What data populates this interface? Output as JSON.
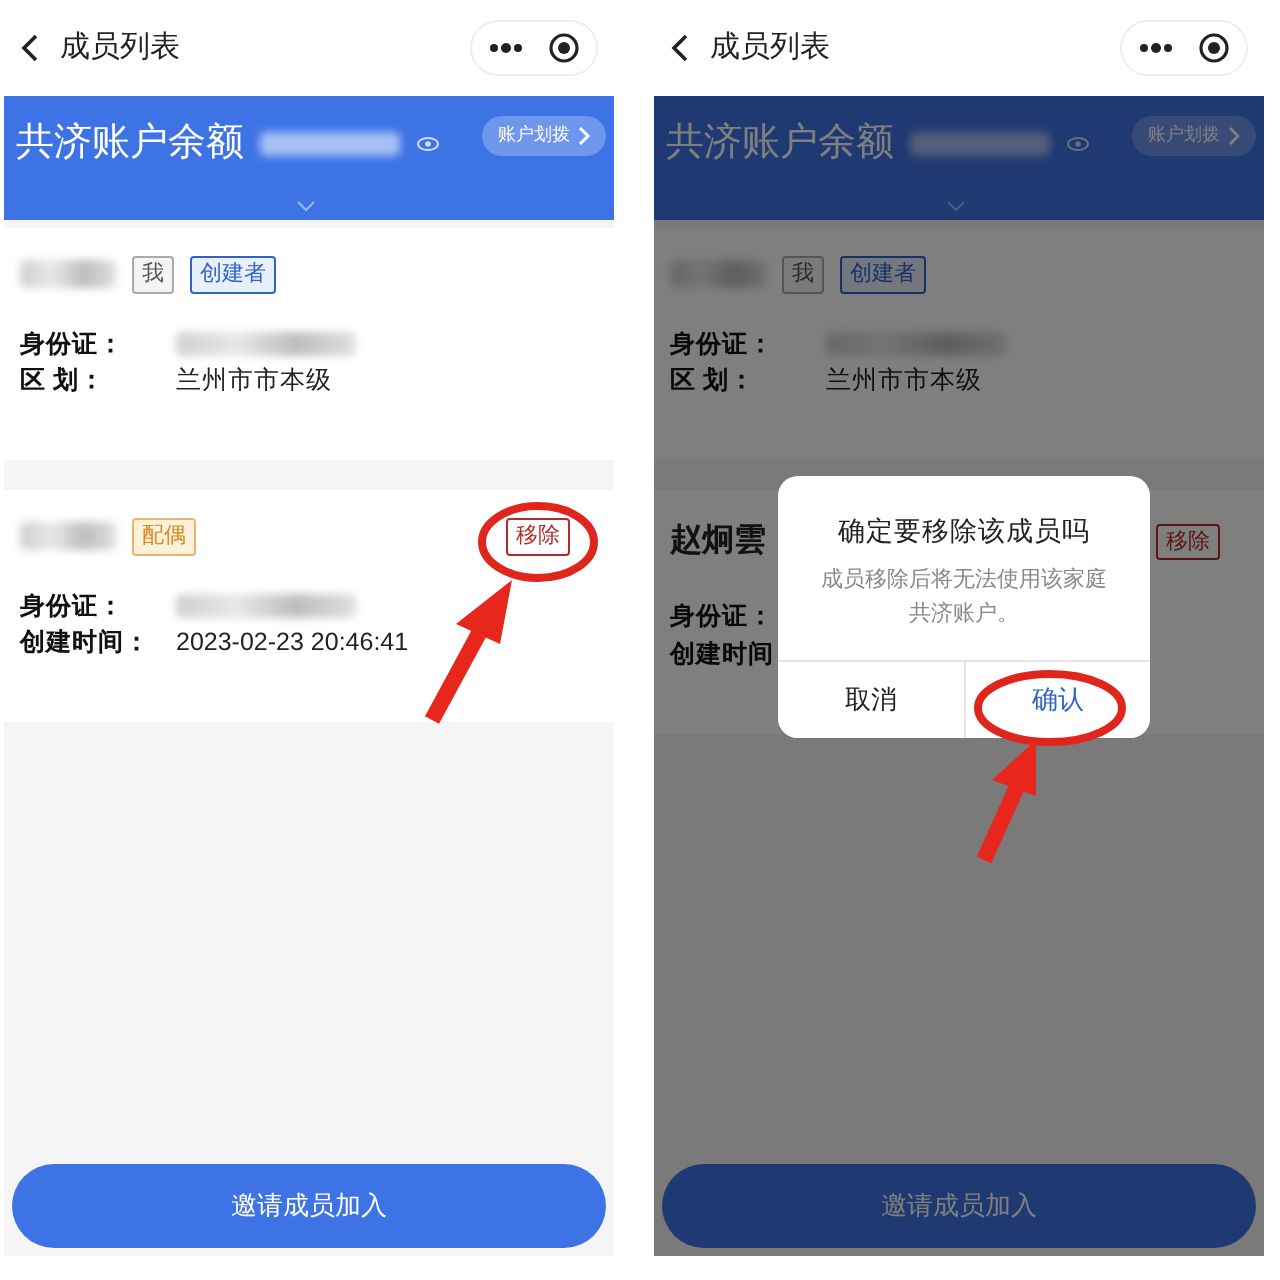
{
  "screens": [
    {
      "nav": {
        "title": "成员列表"
      },
      "banner": {
        "title": "共济账户余额",
        "amount_redacted": true,
        "action": "账户划拨"
      },
      "dimmed": false,
      "members": [
        {
          "name_redacted": true,
          "tags": [
            {
              "kind": "plain",
              "text": "我"
            },
            {
              "kind": "creator",
              "text": "创建者"
            }
          ],
          "removable": false,
          "rows": [
            {
              "label": "身份证：",
              "redacted": true
            },
            {
              "label": "区 划：",
              "value": "兰州市市本级"
            }
          ]
        },
        {
          "name_redacted": true,
          "tags": [
            {
              "kind": "spouse",
              "text": "配偶"
            }
          ],
          "removable": true,
          "remove_label": "移除",
          "rows": [
            {
              "label": "身份证：",
              "redacted": true
            },
            {
              "label": "创建时间：",
              "value": "2023-02-23 20:46:41"
            }
          ]
        }
      ],
      "invite": "邀请成员加入"
    },
    {
      "nav": {
        "title": "成员列表"
      },
      "banner": {
        "title": "共济账户余额",
        "amount_redacted": true,
        "action": "账户划拨"
      },
      "dimmed": true,
      "members": [
        {
          "name_redacted": true,
          "tags": [
            {
              "kind": "plain",
              "text": "我"
            },
            {
              "kind": "creator",
              "text": "创建者"
            }
          ],
          "removable": false,
          "rows": [
            {
              "label": "身份证：",
              "redacted": true
            },
            {
              "label": "区 划：",
              "value": "兰州市市本级"
            }
          ]
        },
        {
          "name": "赵炯雲",
          "removable": true,
          "remove_label": "移除",
          "rows": [
            {
              "label": "身份证："
            },
            {
              "label": "创建时间"
            }
          ]
        }
      ],
      "invite": "邀请成员加入",
      "dialog": {
        "title": "确定要移除该成员吗",
        "message": "成员移除后将无法使用该家庭共济账户。",
        "buttons": [
          {
            "kind": "cancel",
            "text": "取消"
          },
          {
            "kind": "confirm",
            "text": "确认"
          }
        ]
      }
    }
  ]
}
